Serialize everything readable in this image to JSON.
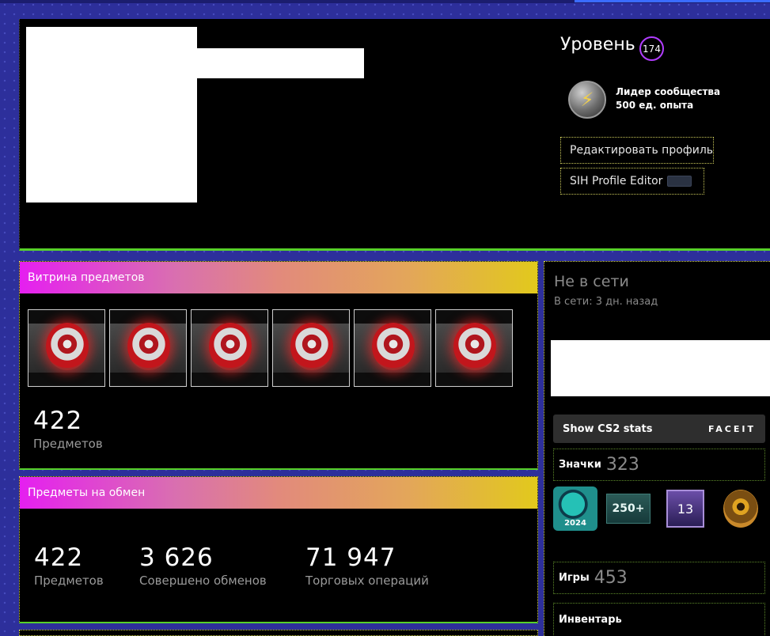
{
  "header": {
    "level_label": "Уровень",
    "level_value": "174",
    "badge": {
      "title": "Лидер сообщества",
      "xp": "500 ед. опыта",
      "icon": "lightning-medal-icon"
    },
    "edit_profile_label": "Редактировать профиль",
    "sih_editor_label": "SIH Profile Editor"
  },
  "showcase": {
    "title": "Витрина предметов",
    "items": [
      {
        "icon": "red-orb-item-icon"
      },
      {
        "icon": "red-orb-item-icon"
      },
      {
        "icon": "red-orb-item-icon"
      },
      {
        "icon": "red-orb-item-icon"
      },
      {
        "icon": "red-orb-item-icon"
      },
      {
        "icon": "red-orb-item-icon"
      }
    ],
    "count": "422",
    "count_label": "Предметов"
  },
  "trade": {
    "title": "Предметы на обмен",
    "stats": [
      {
        "value": "422",
        "label": "Предметов"
      },
      {
        "value": "3 626",
        "label": "Совершено обменов"
      },
      {
        "value": "71 947",
        "label": "Торговых операций"
      }
    ]
  },
  "sidebar": {
    "status": "Не в сети",
    "last_online": "В сети: 3 дн. назад",
    "cs2_button_label": "Show CS2 stats",
    "faceit_label": "FACEIT",
    "badges_label": "Значки",
    "badges_count": "323",
    "badge_icons": [
      {
        "name": "steam-2024-badge-icon",
        "text": "2024"
      },
      {
        "name": "250-plus-badge-icon",
        "text": "250+"
      },
      {
        "name": "level-13-badge-icon",
        "text": "13"
      },
      {
        "name": "golden-eye-badge-icon",
        "text": ""
      }
    ],
    "games_label": "Игры",
    "games_count": "453",
    "inventory_label": "Инвентарь"
  }
}
